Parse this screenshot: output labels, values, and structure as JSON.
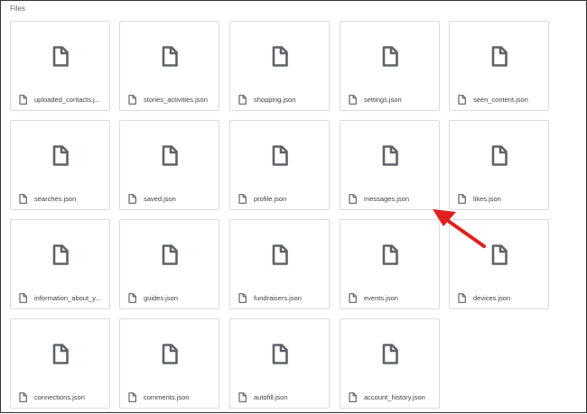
{
  "section": {
    "title": "Files"
  },
  "files": [
    {
      "name": "uploaded_contacts.j..."
    },
    {
      "name": "stories_activities.json"
    },
    {
      "name": "shopping.json"
    },
    {
      "name": "settings.json"
    },
    {
      "name": "seen_content.json"
    },
    {
      "name": "searches.json"
    },
    {
      "name": "saved.json"
    },
    {
      "name": "profile.json"
    },
    {
      "name": "messages.json"
    },
    {
      "name": "likes.json"
    },
    {
      "name": "information_about_y..."
    },
    {
      "name": "guides.json"
    },
    {
      "name": "fundraisers.json"
    },
    {
      "name": "events.json"
    },
    {
      "name": "devices.json"
    },
    {
      "name": "connections.json"
    },
    {
      "name": "comments.json"
    },
    {
      "name": "autofill.json"
    },
    {
      "name": "account_history.json"
    }
  ],
  "icons": {
    "file": "file-icon",
    "annotation": "red-arrow"
  },
  "colors": {
    "icon": "#5f6368",
    "arrow": "#e02020",
    "border": "#dadce0"
  }
}
